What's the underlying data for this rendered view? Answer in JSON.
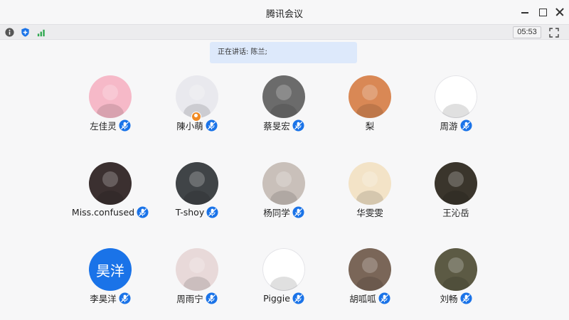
{
  "window": {
    "title": "腾讯会议"
  },
  "toolbar": {
    "timer": "05:53"
  },
  "speaking": {
    "label": "正在讲话: 陈兰;"
  },
  "participants": [
    {
      "name": "左佳灵",
      "mic": true,
      "avatar_bg": "#f6b9c8"
    },
    {
      "name": "陳小萌",
      "mic": true,
      "host": true,
      "avatar_bg": "#e9e9ee"
    },
    {
      "name": "蔡旻宏",
      "mic": true,
      "avatar_bg": "#6b6b6b"
    },
    {
      "name": "梨",
      "mic": false,
      "avatar_bg": "#d98855"
    },
    {
      "name": "周游",
      "mic": true,
      "avatar_bg": "#ffffff"
    },
    {
      "name": "Miss.confused",
      "mic": true,
      "avatar_bg": "#3b3030"
    },
    {
      "name": "T-shoy",
      "mic": true,
      "avatar_bg": "#404447"
    },
    {
      "name": "杨同学",
      "mic": true,
      "avatar_bg": "#c9c0ba"
    },
    {
      "name": "华雯雯",
      "mic": false,
      "avatar_bg": "#f3e3c7"
    },
    {
      "name": "王沁岳",
      "mic": false,
      "avatar_bg": "#3a352c"
    },
    {
      "name": "李昊洋",
      "mic": true,
      "avatar_bg": "#1a73e8",
      "avatar_text": "昊洋"
    },
    {
      "name": "周雨宁",
      "mic": true,
      "avatar_bg": "#e8d9d9"
    },
    {
      "name": "Piggie",
      "mic": true,
      "avatar_bg": "#ffffff"
    },
    {
      "name": "胡呱呱",
      "mic": true,
      "avatar_bg": "#7a6658"
    },
    {
      "name": "刘畅",
      "mic": true,
      "avatar_bg": "#5c5a44"
    }
  ],
  "colors": {
    "accent": "#1a73e8",
    "host_badge": "#f08a24",
    "signal": "#2ea84f"
  }
}
